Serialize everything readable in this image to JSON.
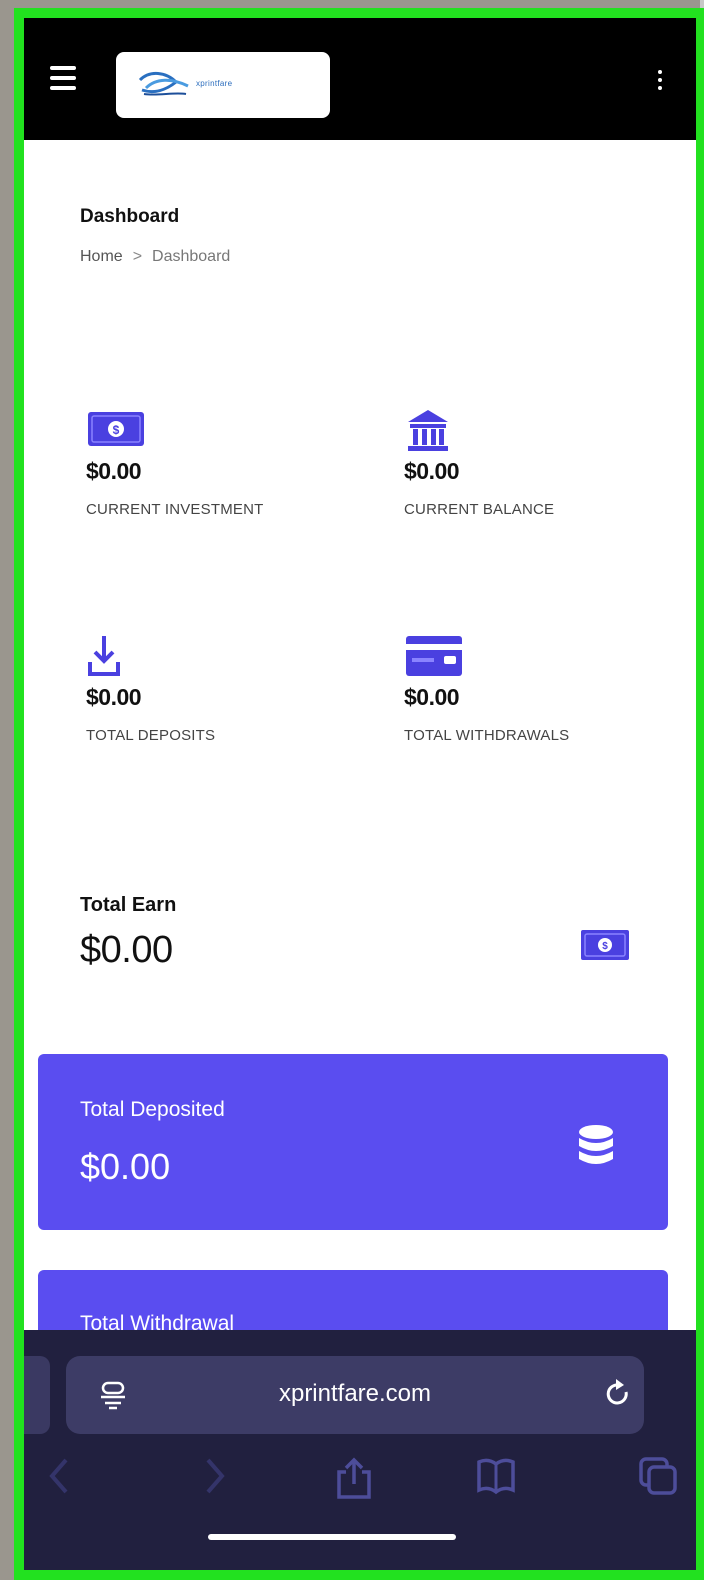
{
  "header": {
    "menu_icon": "hamburger-icon",
    "logo_text": "xprintfare",
    "more_icon": "kebab-icon"
  },
  "page": {
    "title": "Dashboard",
    "breadcrumb": {
      "home": "Home",
      "separator": ">",
      "current": "Dashboard"
    }
  },
  "stats": [
    {
      "icon": "money-icon",
      "value": "$0.00",
      "label": "CURRENT INVESTMENT"
    },
    {
      "icon": "bank-icon",
      "value": "$0.00",
      "label": "CURRENT BALANCE"
    },
    {
      "icon": "download-icon",
      "value": "$0.00",
      "label": "TOTAL DEPOSITS"
    },
    {
      "icon": "credit-card-icon",
      "value": "$0.00",
      "label": "TOTAL WITHDRAWALS"
    }
  ],
  "earn": {
    "label": "Total Earn",
    "value": "$0.00",
    "icon": "money-icon"
  },
  "cards": [
    {
      "label": "Total Deposited",
      "value": "$0.00",
      "icon": "database-icon"
    },
    {
      "label": "Total Withdrawal",
      "value": ""
    }
  ],
  "browser": {
    "url": "xprintfare.com",
    "icons": [
      "page-settings-icon",
      "reload-icon",
      "back-icon",
      "forward-icon",
      "share-icon",
      "bookmarks-icon",
      "tabs-icon"
    ]
  },
  "colors": {
    "accent": "#5a4df0",
    "frame": "#22e11f",
    "topbar": "#000000",
    "browser_chrome": "#21203f"
  }
}
